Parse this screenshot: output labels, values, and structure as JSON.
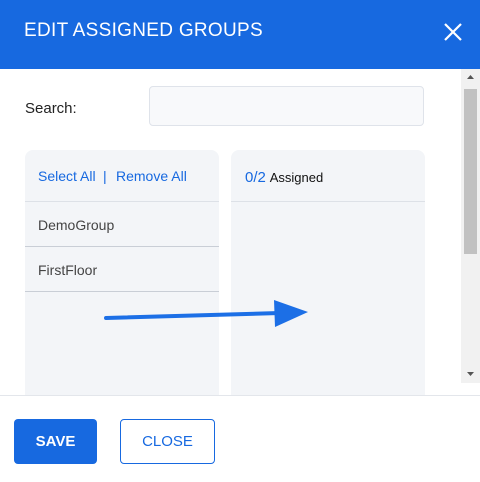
{
  "header": {
    "title": "EDIT ASSIGNED GROUPS"
  },
  "search": {
    "label": "Search:",
    "value": "",
    "placeholder": ""
  },
  "available": {
    "select_all": "Select All",
    "separator": "|",
    "remove_all": "Remove All",
    "items": [
      {
        "label": "DemoGroup"
      },
      {
        "label": "FirstFloor"
      }
    ]
  },
  "assigned": {
    "count": "0/2",
    "label": "Assigned"
  },
  "footer": {
    "save_label": "SAVE",
    "close_label": "CLOSE"
  },
  "colors": {
    "accent": "#1769e0",
    "panel": "#f3f5f8"
  },
  "icons": {
    "close": "close-icon",
    "arrow": "arrow-right-icon"
  }
}
